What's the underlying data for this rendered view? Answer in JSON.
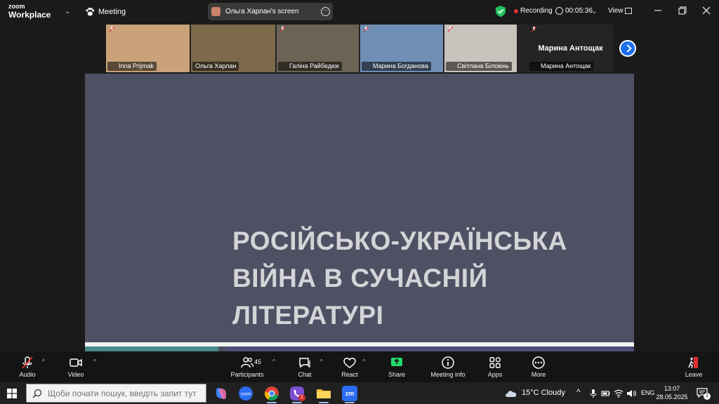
{
  "app": {
    "brand_top": "zoom",
    "brand_bottom": "Workplace"
  },
  "titlebar": {
    "meeting_label": "Meeting",
    "screen_share_label": "Ольга Харлан's screen",
    "recording_label": "Recording",
    "timer": "00:05:36",
    "view_label": "View"
  },
  "participants": [
    {
      "name": "Inna Prijmak",
      "bg": "#c9a27a"
    },
    {
      "name": "Ольга Харлан",
      "bg": "#7d6a4a",
      "active": true
    },
    {
      "name": "Галіна Райбедюк",
      "bg": "#6b6456"
    },
    {
      "name": "Марина Богданова",
      "bg": "#6f8fb5"
    },
    {
      "name": "Світлана Білокінь",
      "bg": "#c8c4bd"
    },
    {
      "name": "Марина Антощак",
      "bg": "#242424",
      "display_name": "Марина Антощак"
    }
  ],
  "slide": {
    "title_line1": "РОСІЙСЬКО-УКРАЇНСЬКА",
    "title_line2": "ВІЙНА В СУЧАСНІЙ",
    "title_line3": "ЛІТЕРАТУРІ",
    "background": "#4e5063",
    "title_color": "#d4d4d8"
  },
  "toolbar": {
    "audio_label": "Audio",
    "video_label": "Video",
    "participants_label": "Participants",
    "participants_count": "45",
    "chat_label": "Chat",
    "react_label": "React",
    "share_label": "Share",
    "meeting_info_label": "Meeting info",
    "apps_label": "Apps",
    "more_label": "More",
    "leave_label": "Leave",
    "share_color": "#23d96b",
    "leave_color": "#e03030"
  },
  "taskbar": {
    "search_placeholder": "Щоби почати пошук, введіть запит тут",
    "zoom_app_text": "zoom",
    "zm_app_text": "zm",
    "viber_badge": "1",
    "weather": "15°C  Cloudy",
    "language": "ENG",
    "time": "13:07",
    "date": "28.05.2025",
    "notification_badge": "1"
  }
}
